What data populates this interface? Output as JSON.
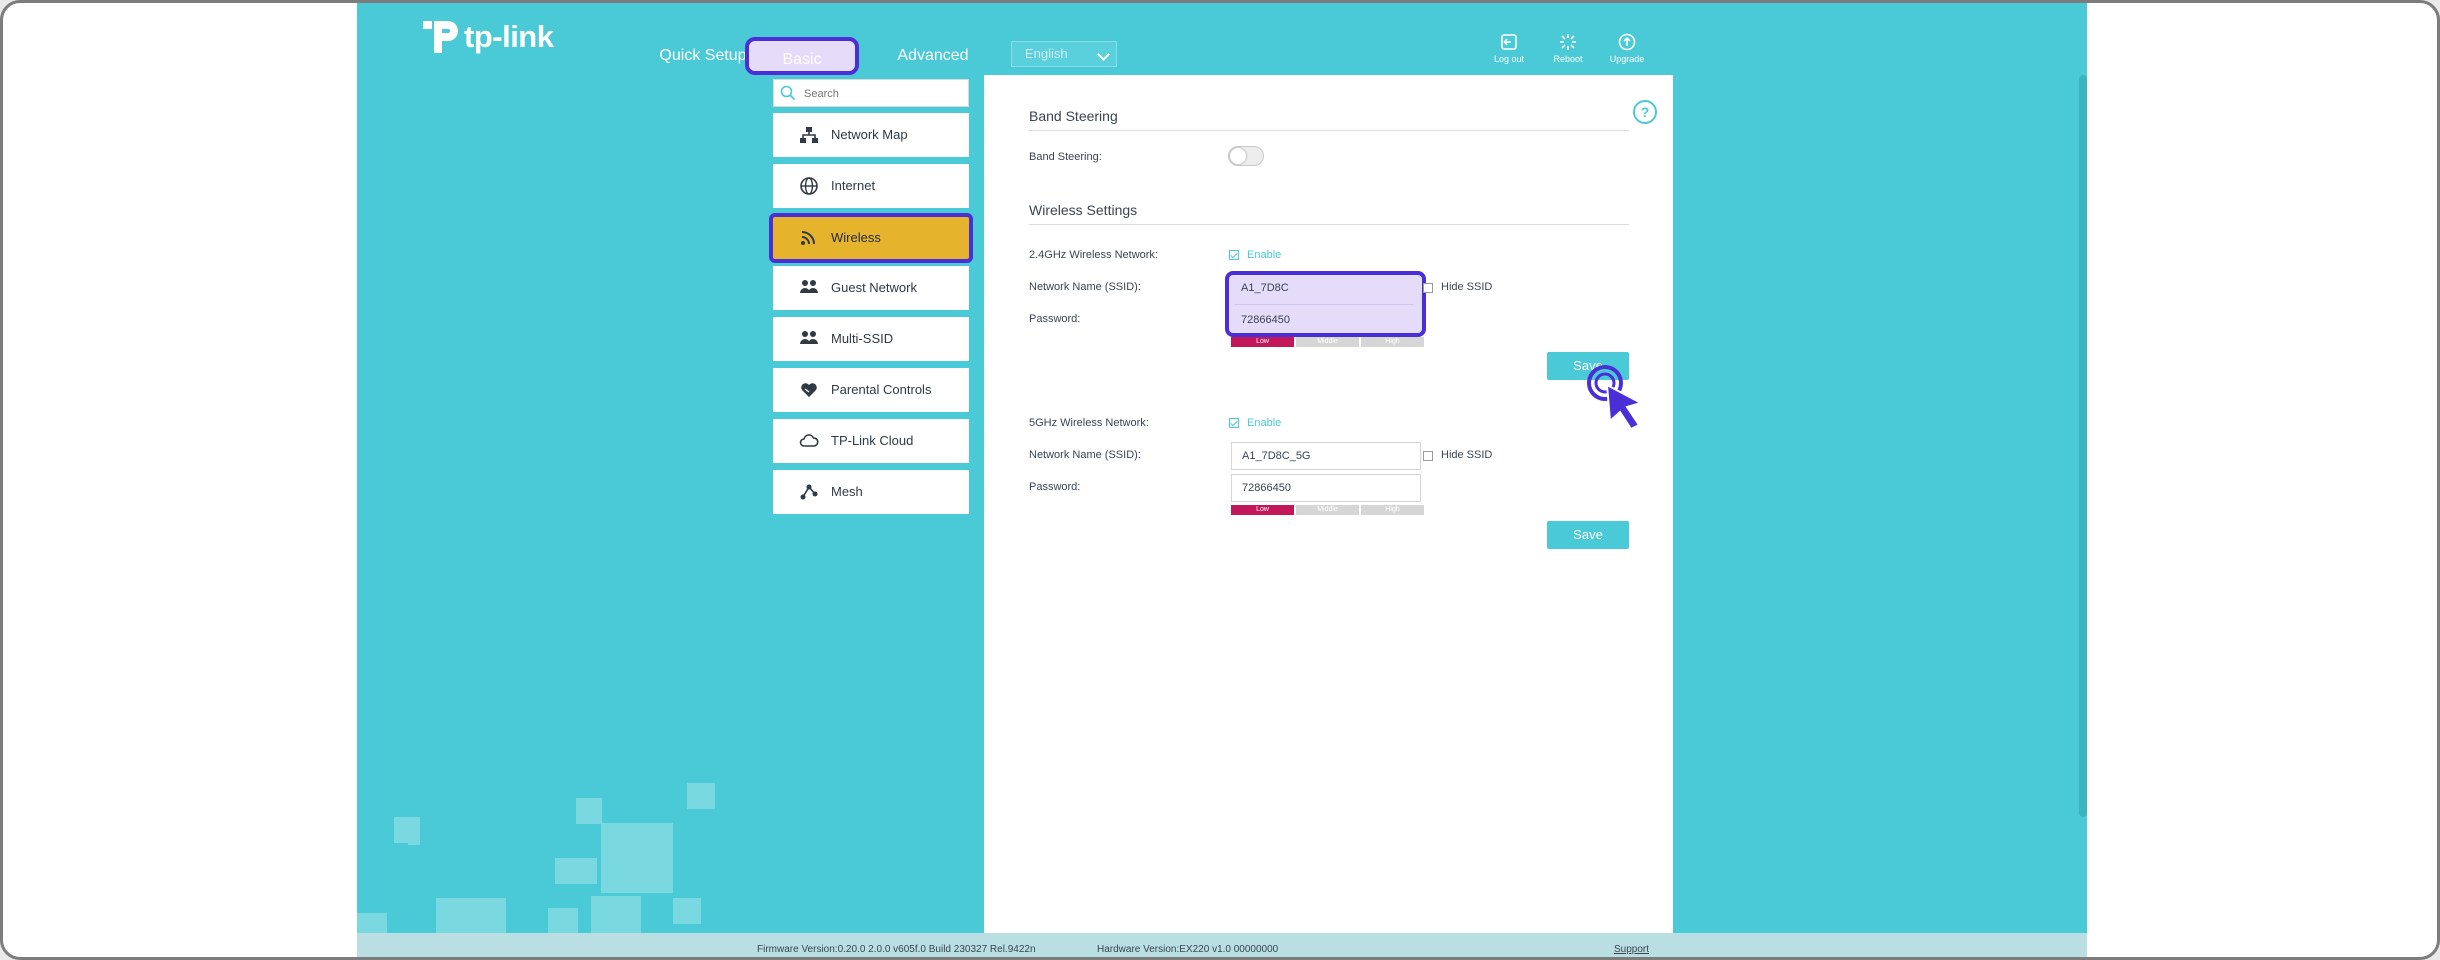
{
  "brand": {
    "name": "tp-link"
  },
  "top_nav": {
    "quick_setup": "Quick Setup",
    "basic": "Basic",
    "advanced": "Advanced"
  },
  "header": {
    "language": "English",
    "logout": "Log out",
    "reboot": "Reboot",
    "upgrade": "Upgrade"
  },
  "search": {
    "placeholder": "Search"
  },
  "sidebar": {
    "items": [
      {
        "label": "Network Map",
        "icon": "network-map-icon"
      },
      {
        "label": "Internet",
        "icon": "globe-icon"
      },
      {
        "label": "Wireless",
        "icon": "wifi-icon",
        "active": true
      },
      {
        "label": "Guest Network",
        "icon": "guest-icon"
      },
      {
        "label": "Multi-SSID",
        "icon": "multi-ssid-icon"
      },
      {
        "label": "Parental Controls",
        "icon": "heart-icon"
      },
      {
        "label": "TP-Link Cloud",
        "icon": "cloud-icon"
      },
      {
        "label": "Mesh",
        "icon": "mesh-icon"
      }
    ]
  },
  "band_steering": {
    "title": "Band Steering",
    "label": "Band Steering:",
    "enabled": false
  },
  "wireless_settings": {
    "title": "Wireless Settings",
    "band24": {
      "label": "2.4GHz Wireless Network:",
      "enable_label": "Enable",
      "enabled": true,
      "ssid_label": "Network Name (SSID):",
      "ssid": "A1_7D8C",
      "hide_ssid": "Hide SSID",
      "password_label": "Password:",
      "password": "72866450",
      "strength": [
        "Low",
        "Middle",
        "High"
      ],
      "save": "Save"
    },
    "band5": {
      "label": "5GHz Wireless Network:",
      "enable_label": "Enable",
      "enabled": true,
      "ssid_label": "Network Name (SSID):",
      "ssid": "A1_7D8C_5G",
      "hide_ssid": "Hide SSID",
      "password_label": "Password:",
      "password": "72866450",
      "strength": [
        "Low",
        "Middle",
        "High"
      ],
      "save": "Save"
    }
  },
  "footer": {
    "firmware": "Firmware Version:0.20.0 2.0.0 v605f.0 Build 230327 Rel.9422n",
    "hardware": "Hardware Version:EX220 v1.0 00000000",
    "support": "Support"
  },
  "colors": {
    "teal": "#4ac9d6",
    "active": "#e6b32c",
    "highlight": "#4a2fd6",
    "low_strength": "#c2185b"
  }
}
